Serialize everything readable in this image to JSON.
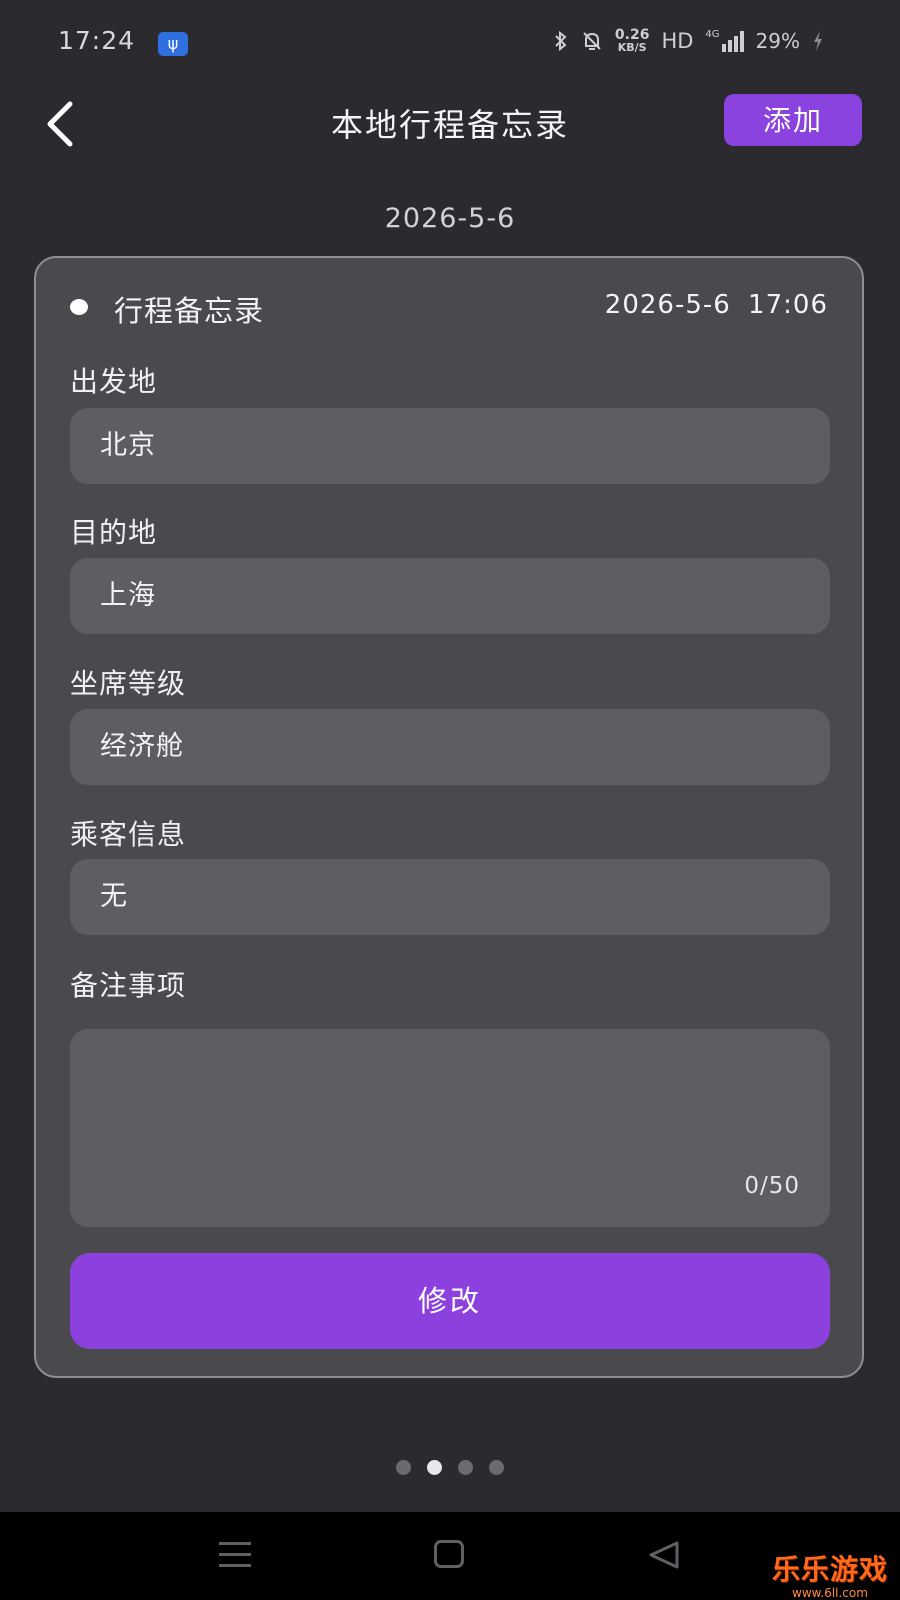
{
  "status": {
    "time": "17:24",
    "usb_symbol": "ψ",
    "speed_value": "0.26",
    "speed_unit": "KB/S",
    "hd": "HD",
    "network": "4G",
    "battery": "29%"
  },
  "header": {
    "title": "本地行程备忘录",
    "add_label": "添加"
  },
  "date_label": "2026-5-6",
  "card": {
    "title": "行程备忘录",
    "timestamp": "2026-5-6  17:06",
    "departure": {
      "label": "出发地",
      "value": "北京"
    },
    "destination": {
      "label": "目的地",
      "value": "上海"
    },
    "seat_class": {
      "label": "坐席等级",
      "value": "经济舱"
    },
    "passenger": {
      "label": "乘客信息",
      "value": "无"
    },
    "notes": {
      "label": "备注事项",
      "value": "",
      "count": "0/50"
    },
    "modify_label": "修改"
  },
  "pager": {
    "total": 4,
    "active_index": 1
  },
  "watermark": {
    "main": "乐乐游戏",
    "sub": "www.6ll.com"
  },
  "colors": {
    "background": "#2b2a2f",
    "card": "#4a4a4e",
    "field": "#5d5e61",
    "accent": "#8c41df"
  }
}
